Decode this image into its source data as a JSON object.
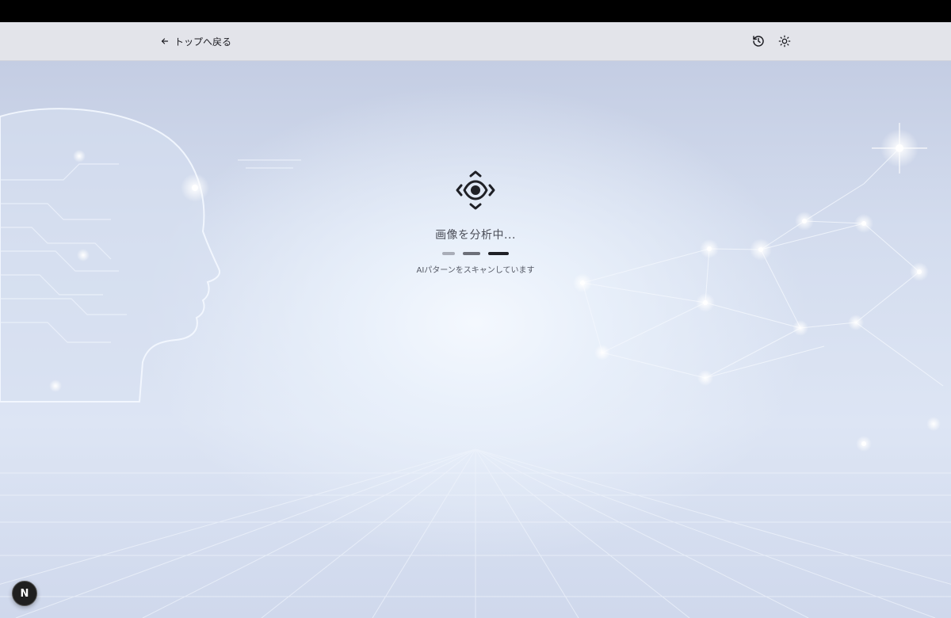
{
  "nav": {
    "back_label": "トップへ戻る",
    "back_icon": "arrow-left-icon",
    "history_icon": "history-icon",
    "theme_icon": "sun-icon"
  },
  "status": {
    "icon": "scan-eye-icon",
    "title": "画像を分析中...",
    "subtitle": "AIパターンをスキャンしています",
    "progress_steps": 3
  },
  "badge": {
    "label": "N"
  },
  "colors": {
    "navbar_bg": "#e3e4ea",
    "background_blue": "#d3dcee",
    "text_dark": "#1c1c22"
  }
}
